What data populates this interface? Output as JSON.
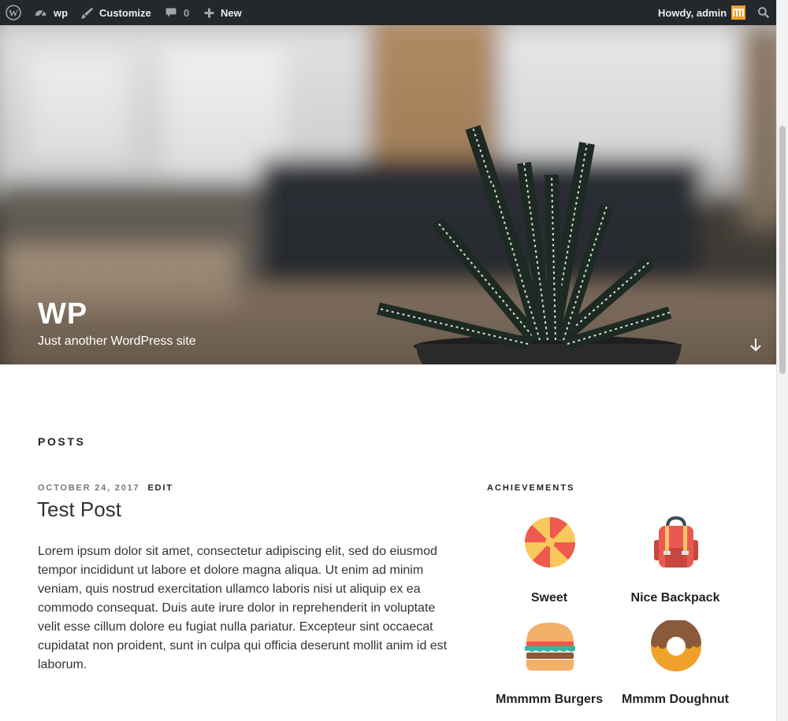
{
  "admin_bar": {
    "site_name": "wp",
    "customize": "Customize",
    "comments_count": "0",
    "new": "New",
    "greeting": "Howdy, admin",
    "icons": [
      "wordpress-logo-icon",
      "dashboard-icon",
      "brush-icon",
      "comment-icon",
      "plus-icon",
      "search-icon"
    ]
  },
  "header": {
    "title": "WP",
    "tagline": "Just another WordPress site"
  },
  "posts": {
    "heading": "POSTS",
    "items": [
      {
        "date": "OCTOBER 24, 2017",
        "edit": "EDIT",
        "title": "Test Post",
        "body": "Lorem ipsum dolor sit amet, consectetur adipiscing elit, sed do eiusmod tempor incididunt ut labore et dolore magna aliqua. Ut enim ad minim veniam, quis nostrud exercitation ullamco laboris nisi ut aliquip ex ea commodo consequat. Duis aute irure dolor in reprehenderit in voluptate velit esse cillum dolore eu fugiat nulla pariatur. Excepteur sint occaecat cupidatat non proident, sunt in culpa qui officia deserunt mollit anim id est laborum."
      }
    ]
  },
  "achievements": {
    "heading": "ACHIEVEMENTS",
    "items": [
      {
        "label": "Sweet",
        "icon": "lollipop-icon"
      },
      {
        "label": "Nice Backpack",
        "icon": "backpack-icon"
      },
      {
        "label": "Mmmmm Burgers",
        "icon": "burger-icon"
      },
      {
        "label": "Mmmm Doughnut",
        "icon": "doughnut-icon"
      }
    ]
  },
  "colors": {
    "admin_bar_bg": "#23282d",
    "avatar": "#f0a12a",
    "text": "#222222"
  }
}
